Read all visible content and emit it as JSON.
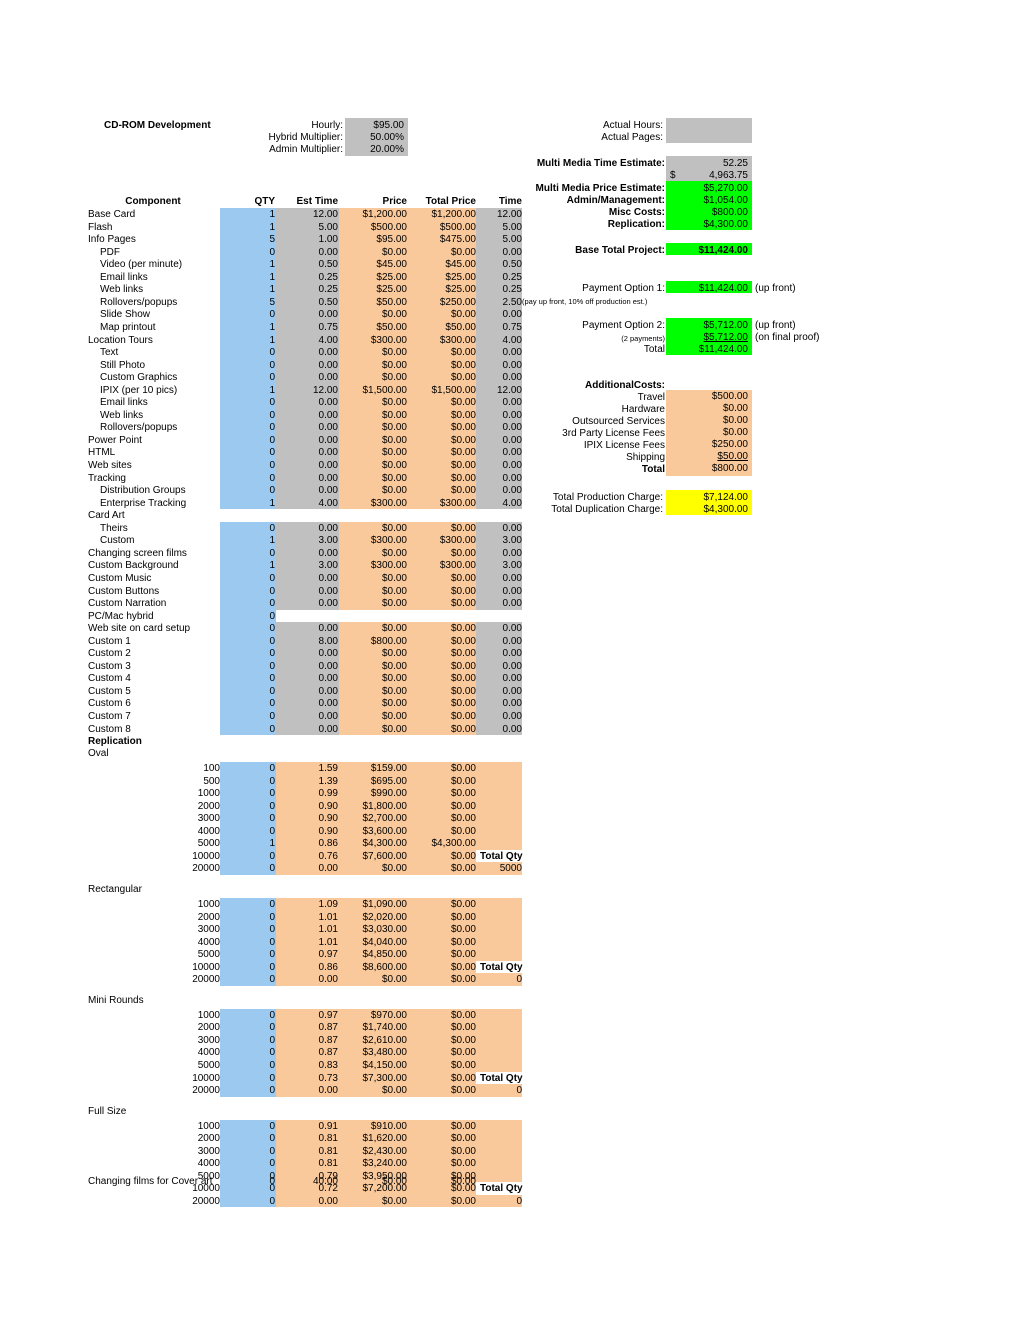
{
  "title": "CD-ROM Development",
  "rates": [
    {
      "label": "Hourly:",
      "value": "$95.00"
    },
    {
      "label": "Hybrid Multiplier:",
      "value": "50.00%"
    },
    {
      "label": "Admin Multiplier:",
      "value": "20.00%"
    }
  ],
  "actuals": [
    {
      "label": "Actual Hours:",
      "value": ""
    },
    {
      "label": "Actual Pages:",
      "value": ""
    }
  ],
  "summary": {
    "time_estimate_label": "Multi Media Time Estimate:",
    "time_estimate_value": "52.25",
    "dollar_sign": "$",
    "dollar_value": "4,963.75",
    "rows": [
      {
        "label": "Multi Media Price Estimate:",
        "value": "$5,270.00"
      },
      {
        "label": "Admin/Management:",
        "value": "$1,054.00"
      },
      {
        "label": "Misc Costs:",
        "value": "$800.00"
      },
      {
        "label": "Replication:",
        "value": "$4,300.00"
      }
    ],
    "base_total_label": "Base Total Project:",
    "base_total_value": "$11,424.00"
  },
  "payments": {
    "option1_label": "Payment Option 1:",
    "option1_value": "$11,424.00",
    "option1_note": "(up front)",
    "option1_sub": "(pay up front, 10% off production est.)",
    "option2_label": "Payment Option 2:",
    "option2_value": "$5,712.00",
    "option2_note": "(up front)",
    "option2b_label": "(2 payments)",
    "option2b_value": "$5,712.00",
    "option2b_note": "(on final proof)",
    "total_label": "Total",
    "total_value": "$11,424.00"
  },
  "additional": {
    "heading": "AdditionalCosts:",
    "rows": [
      {
        "label": "Travel",
        "value": "$500.00"
      },
      {
        "label": "Hardware",
        "value": "$0.00"
      },
      {
        "label": "Outsourced Services",
        "value": "$0.00"
      },
      {
        "label": "3rd Party License Fees",
        "value": "$0.00"
      },
      {
        "label": "IPIX License Fees",
        "value": "$250.00"
      },
      {
        "label": "Shipping",
        "value": "$50.00"
      },
      {
        "label": "Total",
        "value": "$800.00"
      }
    ]
  },
  "charges": [
    {
      "label": "Total Production Charge:",
      "value": "$7,124.00"
    },
    {
      "label": "Total Duplication Charge:",
      "value": "$4,300.00"
    }
  ],
  "table": {
    "headers": [
      "Component",
      "QTY",
      "Est Time",
      "Price",
      "Total Price",
      "Time"
    ],
    "rows": [
      {
        "label": "Base Card",
        "indent": 0,
        "qty": "1",
        "est": "12.00",
        "price": "$1,200.00",
        "total": "$1,200.00",
        "time": "12.00"
      },
      {
        "label": "Flash",
        "indent": 0,
        "qty": "1",
        "est": "5.00",
        "price": "$500.00",
        "total": "$500.00",
        "time": "5.00"
      },
      {
        "label": "Info Pages",
        "indent": 0,
        "qty": "5",
        "est": "1.00",
        "price": "$95.00",
        "total": "$475.00",
        "time": "5.00"
      },
      {
        "label": "PDF",
        "indent": 1,
        "qty": "0",
        "est": "0.00",
        "price": "$0.00",
        "total": "$0.00",
        "time": "0.00"
      },
      {
        "label": "Video (per minute)",
        "indent": 1,
        "qty": "1",
        "est": "0.50",
        "price": "$45.00",
        "total": "$45.00",
        "time": "0.50"
      },
      {
        "label": "Email links",
        "indent": 1,
        "qty": "1",
        "est": "0.25",
        "price": "$25.00",
        "total": "$25.00",
        "time": "0.25"
      },
      {
        "label": "Web links",
        "indent": 1,
        "qty": "1",
        "est": "0.25",
        "price": "$25.00",
        "total": "$25.00",
        "time": "0.25"
      },
      {
        "label": "Rollovers/popups",
        "indent": 1,
        "qty": "5",
        "est": "0.50",
        "price": "$50.00",
        "total": "$250.00",
        "time": "2.50"
      },
      {
        "label": "Slide Show",
        "indent": 1,
        "qty": "0",
        "est": "0.00",
        "price": "$0.00",
        "total": "$0.00",
        "time": "0.00"
      },
      {
        "label": "Map printout",
        "indent": 1,
        "qty": "1",
        "est": "0.75",
        "price": "$50.00",
        "total": "$50.00",
        "time": "0.75"
      },
      {
        "label": "Location Tours",
        "indent": 0,
        "qty": "1",
        "est": "4.00",
        "price": "$300.00",
        "total": "$300.00",
        "time": "4.00"
      },
      {
        "label": "Text",
        "indent": 1,
        "qty": "0",
        "est": "0.00",
        "price": "$0.00",
        "total": "$0.00",
        "time": "0.00"
      },
      {
        "label": "Still Photo",
        "indent": 1,
        "qty": "0",
        "est": "0.00",
        "price": "$0.00",
        "total": "$0.00",
        "time": "0.00"
      },
      {
        "label": "Custom Graphics",
        "indent": 1,
        "qty": "0",
        "est": "0.00",
        "price": "$0.00",
        "total": "$0.00",
        "time": "0.00"
      },
      {
        "label": "IPIX (per 10 pics)",
        "indent": 1,
        "qty": "1",
        "est": "12.00",
        "price": "$1,500.00",
        "total": "$1,500.00",
        "time": "12.00"
      },
      {
        "label": "Email links",
        "indent": 1,
        "qty": "0",
        "est": "0.00",
        "price": "$0.00",
        "total": "$0.00",
        "time": "0.00"
      },
      {
        "label": "Web links",
        "indent": 1,
        "qty": "0",
        "est": "0.00",
        "price": "$0.00",
        "total": "$0.00",
        "time": "0.00"
      },
      {
        "label": "Rollovers/popups",
        "indent": 1,
        "qty": "0",
        "est": "0.00",
        "price": "$0.00",
        "total": "$0.00",
        "time": "0.00"
      },
      {
        "label": "Power Point",
        "indent": 0,
        "qty": "0",
        "est": "0.00",
        "price": "$0.00",
        "total": "$0.00",
        "time": "0.00"
      },
      {
        "label": "HTML",
        "indent": 0,
        "qty": "0",
        "est": "0.00",
        "price": "$0.00",
        "total": "$0.00",
        "time": "0.00"
      },
      {
        "label": "Web sites",
        "indent": 0,
        "qty": "0",
        "est": "0.00",
        "price": "$0.00",
        "total": "$0.00",
        "time": "0.00"
      },
      {
        "label": "Tracking",
        "indent": 0,
        "qty": "0",
        "est": "0.00",
        "price": "$0.00",
        "total": "$0.00",
        "time": "0.00"
      },
      {
        "label": "Distribution Groups",
        "indent": 1,
        "qty": "0",
        "est": "0.00",
        "price": "$0.00",
        "total": "$0.00",
        "time": "0.00"
      },
      {
        "label": "Enterprise Tracking",
        "indent": 1,
        "qty": "1",
        "est": "4.00",
        "price": "$300.00",
        "total": "$300.00",
        "time": "4.00"
      },
      {
        "label": "Card Art",
        "indent": 0,
        "qty": "",
        "est": "",
        "price": "",
        "total": "",
        "time": "",
        "empty": true
      },
      {
        "label": "Theirs",
        "indent": 1,
        "qty": "0",
        "est": "0.00",
        "price": "$0.00",
        "total": "$0.00",
        "time": "0.00"
      },
      {
        "label": "Custom",
        "indent": 1,
        "qty": "1",
        "est": "3.00",
        "price": "$300.00",
        "total": "$300.00",
        "time": "3.00"
      },
      {
        "label": "Changing screen films",
        "indent": 0,
        "qty": "0",
        "est": "0.00",
        "price": "$0.00",
        "total": "$0.00",
        "time": "0.00"
      },
      {
        "label": "Custom Background",
        "indent": 0,
        "qty": "1",
        "est": "3.00",
        "price": "$300.00",
        "total": "$300.00",
        "time": "3.00"
      },
      {
        "label": "Custom Music",
        "indent": 0,
        "qty": "0",
        "est": "0.00",
        "price": "$0.00",
        "total": "$0.00",
        "time": "0.00"
      },
      {
        "label": "Custom Buttons",
        "indent": 0,
        "qty": "0",
        "est": "0.00",
        "price": "$0.00",
        "total": "$0.00",
        "time": "0.00"
      },
      {
        "label": "Custom Narration",
        "indent": 0,
        "qty": "0",
        "est": "0.00",
        "price": "$0.00",
        "total": "$0.00",
        "time": "0.00"
      },
      {
        "label": "PC/Mac hybrid",
        "indent": 0,
        "qty": "0",
        "est": "",
        "price": "",
        "total": "",
        "time": "",
        "qtyonly": true
      },
      {
        "label": "Web site on card setup",
        "indent": 0,
        "qty": "0",
        "est": "0.00",
        "price": "$0.00",
        "total": "$0.00",
        "time": "0.00"
      },
      {
        "label": "Custom 1",
        "indent": 0,
        "qty": "0",
        "est": "8.00",
        "price": "$800.00",
        "total": "$0.00",
        "time": "0.00"
      },
      {
        "label": "Custom 2",
        "indent": 0,
        "qty": "0",
        "est": "0.00",
        "price": "$0.00",
        "total": "$0.00",
        "time": "0.00"
      },
      {
        "label": "Custom 3",
        "indent": 0,
        "qty": "0",
        "est": "0.00",
        "price": "$0.00",
        "total": "$0.00",
        "time": "0.00"
      },
      {
        "label": "Custom 4",
        "indent": 0,
        "qty": "0",
        "est": "0.00",
        "price": "$0.00",
        "total": "$0.00",
        "time": "0.00"
      },
      {
        "label": "Custom 5",
        "indent": 0,
        "qty": "0",
        "est": "0.00",
        "price": "$0.00",
        "total": "$0.00",
        "time": "0.00"
      },
      {
        "label": "Custom 6",
        "indent": 0,
        "qty": "0",
        "est": "0.00",
        "price": "$0.00",
        "total": "$0.00",
        "time": "0.00"
      },
      {
        "label": "Custom 7",
        "indent": 0,
        "qty": "0",
        "est": "0.00",
        "price": "$0.00",
        "total": "$0.00",
        "time": "0.00"
      },
      {
        "label": "Custom 8",
        "indent": 0,
        "qty": "0",
        "est": "0.00",
        "price": "$0.00",
        "total": "$0.00",
        "time": "0.00"
      }
    ]
  },
  "replication": {
    "heading": "Replication",
    "total_qty_label": "Total Qty",
    "groups": [
      {
        "name": "Oval",
        "total": "5000",
        "rows": [
          {
            "qty_label": "100",
            "qty": "0",
            "est": "1.59",
            "price": "$159.00",
            "total": "$0.00"
          },
          {
            "qty_label": "500",
            "qty": "0",
            "est": "1.39",
            "price": "$695.00",
            "total": "$0.00"
          },
          {
            "qty_label": "1000",
            "qty": "0",
            "est": "0.99",
            "price": "$990.00",
            "total": "$0.00"
          },
          {
            "qty_label": "2000",
            "qty": "0",
            "est": "0.90",
            "price": "$1,800.00",
            "total": "$0.00"
          },
          {
            "qty_label": "3000",
            "qty": "0",
            "est": "0.90",
            "price": "$2,700.00",
            "total": "$0.00"
          },
          {
            "qty_label": "4000",
            "qty": "0",
            "est": "0.90",
            "price": "$3,600.00",
            "total": "$0.00"
          },
          {
            "qty_label": "5000",
            "qty": "1",
            "est": "0.86",
            "price": "$4,300.00",
            "total": "$4,300.00"
          },
          {
            "qty_label": "10000",
            "qty": "0",
            "est": "0.76",
            "price": "$7,600.00",
            "total": "$0.00"
          },
          {
            "qty_label": "20000",
            "qty": "0",
            "est": "0.00",
            "price": "$0.00",
            "total": "$0.00"
          }
        ]
      },
      {
        "name": "Rectangular",
        "total": "0",
        "rows": [
          {
            "qty_label": "1000",
            "qty": "0",
            "est": "1.09",
            "price": "$1,090.00",
            "total": "$0.00"
          },
          {
            "qty_label": "2000",
            "qty": "0",
            "est": "1.01",
            "price": "$2,020.00",
            "total": "$0.00"
          },
          {
            "qty_label": "3000",
            "qty": "0",
            "est": "1.01",
            "price": "$3,030.00",
            "total": "$0.00"
          },
          {
            "qty_label": "4000",
            "qty": "0",
            "est": "1.01",
            "price": "$4,040.00",
            "total": "$0.00"
          },
          {
            "qty_label": "5000",
            "qty": "0",
            "est": "0.97",
            "price": "$4,850.00",
            "total": "$0.00"
          },
          {
            "qty_label": "10000",
            "qty": "0",
            "est": "0.86",
            "price": "$8,600.00",
            "total": "$0.00"
          },
          {
            "qty_label": "20000",
            "qty": "0",
            "est": "0.00",
            "price": "$0.00",
            "total": "$0.00"
          }
        ]
      },
      {
        "name": "Mini Rounds",
        "total": "0",
        "rows": [
          {
            "qty_label": "1000",
            "qty": "0",
            "est": "0.97",
            "price": "$970.00",
            "total": "$0.00"
          },
          {
            "qty_label": "2000",
            "qty": "0",
            "est": "0.87",
            "price": "$1,740.00",
            "total": "$0.00"
          },
          {
            "qty_label": "3000",
            "qty": "0",
            "est": "0.87",
            "price": "$2,610.00",
            "total": "$0.00"
          },
          {
            "qty_label": "4000",
            "qty": "0",
            "est": "0.87",
            "price": "$3,480.00",
            "total": "$0.00"
          },
          {
            "qty_label": "5000",
            "qty": "0",
            "est": "0.83",
            "price": "$4,150.00",
            "total": "$0.00"
          },
          {
            "qty_label": "10000",
            "qty": "0",
            "est": "0.73",
            "price": "$7,300.00",
            "total": "$0.00"
          },
          {
            "qty_label": "20000",
            "qty": "0",
            "est": "0.00",
            "price": "$0.00",
            "total": "$0.00"
          }
        ]
      },
      {
        "name": "Full Size",
        "total": "0",
        "rows": [
          {
            "qty_label": "1000",
            "qty": "0",
            "est": "0.91",
            "price": "$910.00",
            "total": "$0.00"
          },
          {
            "qty_label": "2000",
            "qty": "0",
            "est": "0.81",
            "price": "$1,620.00",
            "total": "$0.00"
          },
          {
            "qty_label": "3000",
            "qty": "0",
            "est": "0.81",
            "price": "$2,430.00",
            "total": "$0.00"
          },
          {
            "qty_label": "4000",
            "qty": "0",
            "est": "0.81",
            "price": "$3,240.00",
            "total": "$0.00"
          },
          {
            "qty_label": "5000",
            "qty": "0",
            "est": "0.79",
            "price": "$3,950.00",
            "total": "$0.00"
          },
          {
            "qty_label": "10000",
            "qty": "0",
            "est": "0.72",
            "price": "$7,200.00",
            "total": "$0.00"
          },
          {
            "qty_label": "20000",
            "qty": "0",
            "est": "0.00",
            "price": "$0.00",
            "total": "$0.00"
          }
        ]
      }
    ],
    "cover_art": {
      "label": "Changing films for Cover art",
      "qty": "0",
      "est": "40.00",
      "price": "$0.00",
      "total": "$0.00"
    }
  },
  "colors": {
    "input_blue": "#9cc9f0",
    "calc_gray": "#c0c0c0",
    "money_orange": "#fac99b",
    "highlight_green": "#00ff00",
    "highlight_yellow": "#ffff00"
  }
}
